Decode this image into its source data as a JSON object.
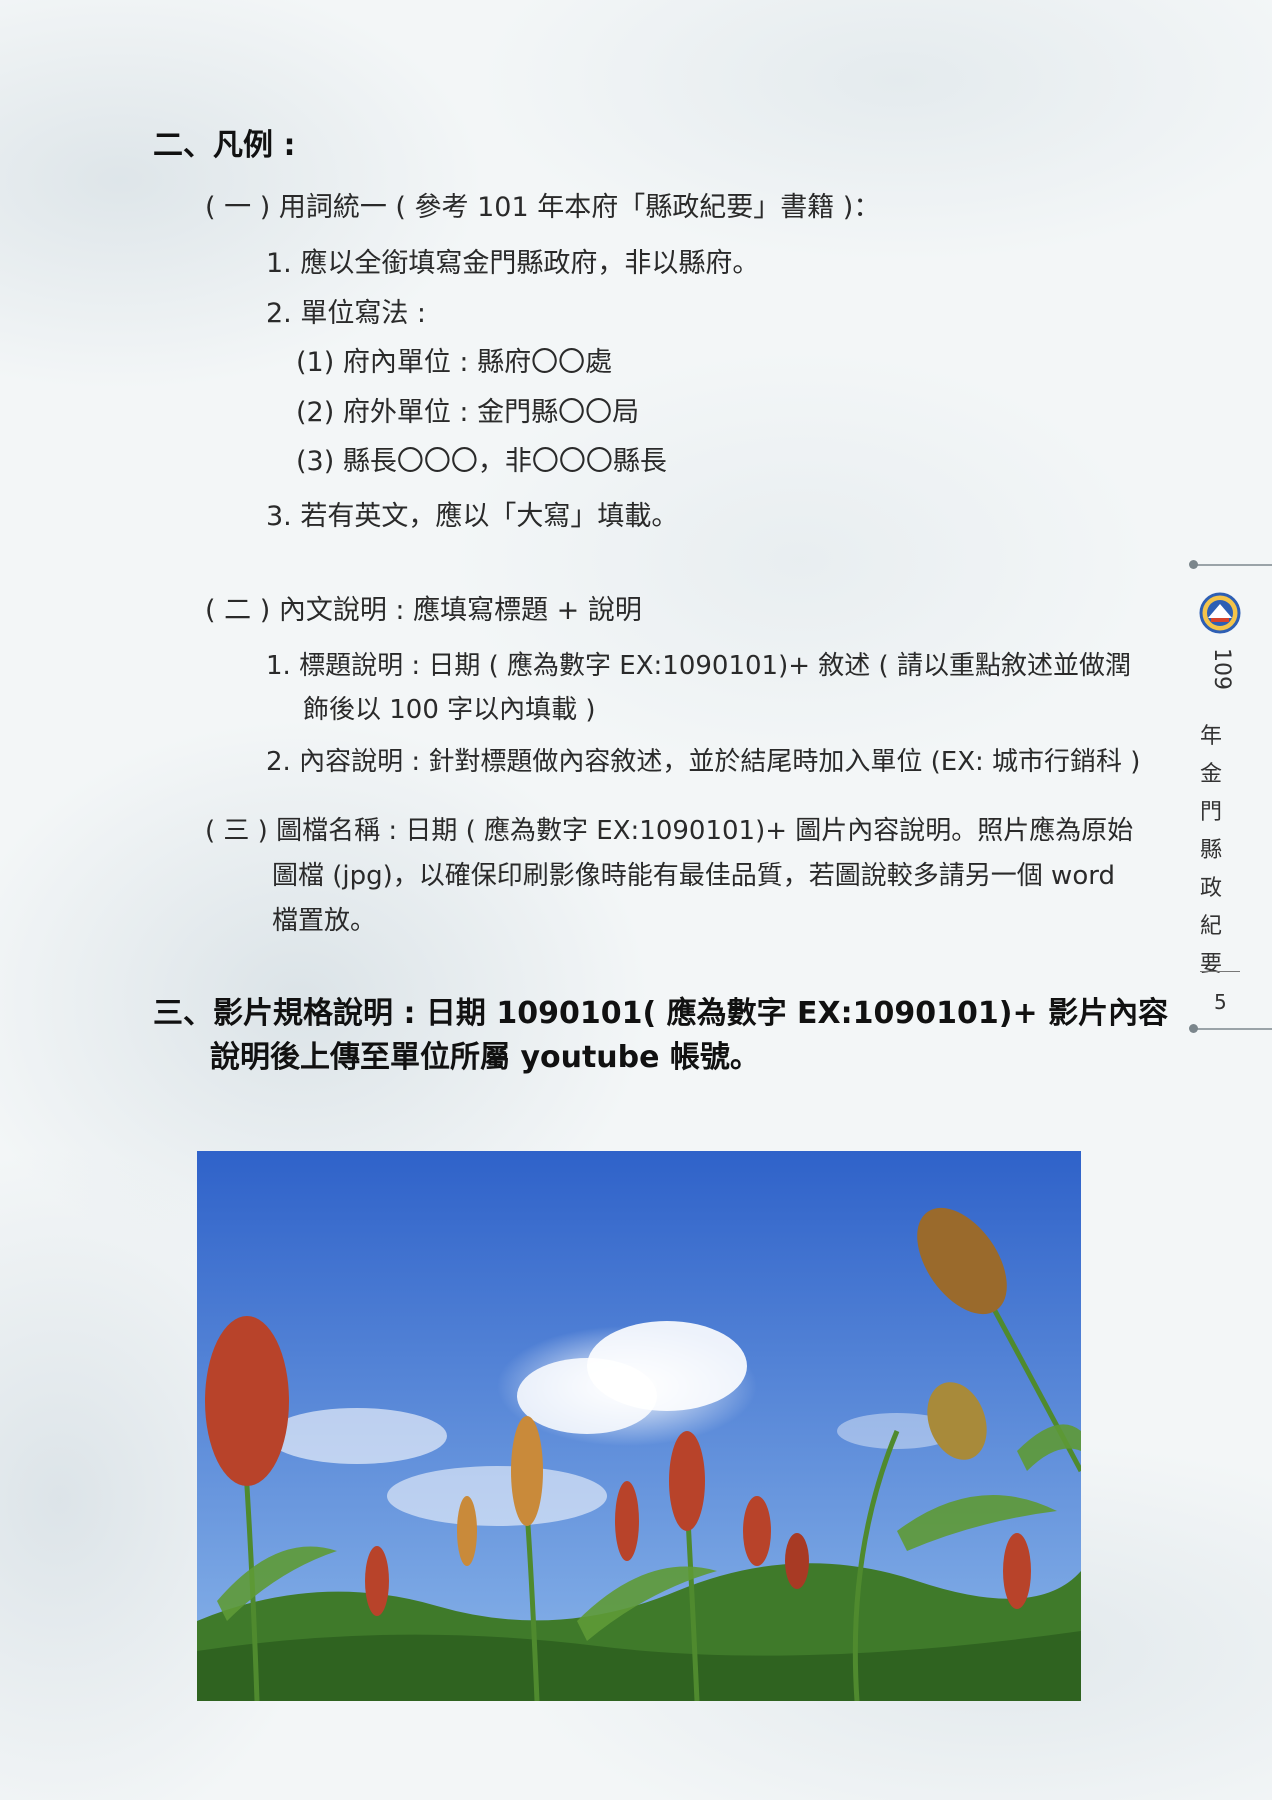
{
  "sections": {
    "s2_title": "二、凡例 :",
    "s2_1": {
      "heading": "( 一 ) 用詞統一 ( 參考 101 年本府「縣政紀要」書籍 )：",
      "item1": "1. 應以全銜填寫金門縣政府，非以縣府。",
      "item2": "2. 單位寫法 :",
      "sub1": "(1) 府內單位 : 縣府〇〇處",
      "sub2": "(2) 府外單位 : 金門縣〇〇局",
      "sub3": "(3) 縣長〇〇〇，非〇〇〇縣長",
      "item3": "3. 若有英文，應以「大寫」填載。"
    },
    "s2_2": {
      "heading": "( 二 ) 內文說明 : 應填寫標題 + 說明",
      "item1_line1": "1. 標題說明 : 日期 ( 應為數字 EX:1090101)+ 敘述 ( 請以重點敘述並做潤",
      "item1_line2": "飾後以 100 字以內填載 )",
      "item2": "2. 內容說明 : 針對標題做內容敘述，並於結尾時加入單位 (EX: 城市行銷科 )"
    },
    "s2_3": {
      "line1": "( 三 ) 圖檔名稱 : 日期 ( 應為數字 EX:1090101)+ 圖片內容說明。照片應為原始",
      "line2": "圖檔 (jpg)，以確保印刷影像時能有最佳品質，若圖說較多請另一個 word",
      "line3": "檔置放。"
    },
    "s3": {
      "line1": "三、影片規格說明 : 日期 1090101( 應為數字 EX:1090101)+ 影片內容",
      "line2": "說明後上傳至單位所屬 youtube 帳號。"
    }
  },
  "side": {
    "year": "109",
    "title": "年金門縣政紀要",
    "page": "5"
  },
  "photo": {
    "sky_top": "#2f62c9",
    "sky_bottom": "#8bb6ea",
    "grain_red": "#b8432a",
    "grain_gold": "#c98a3a",
    "foliage": "#3f7a2a"
  }
}
